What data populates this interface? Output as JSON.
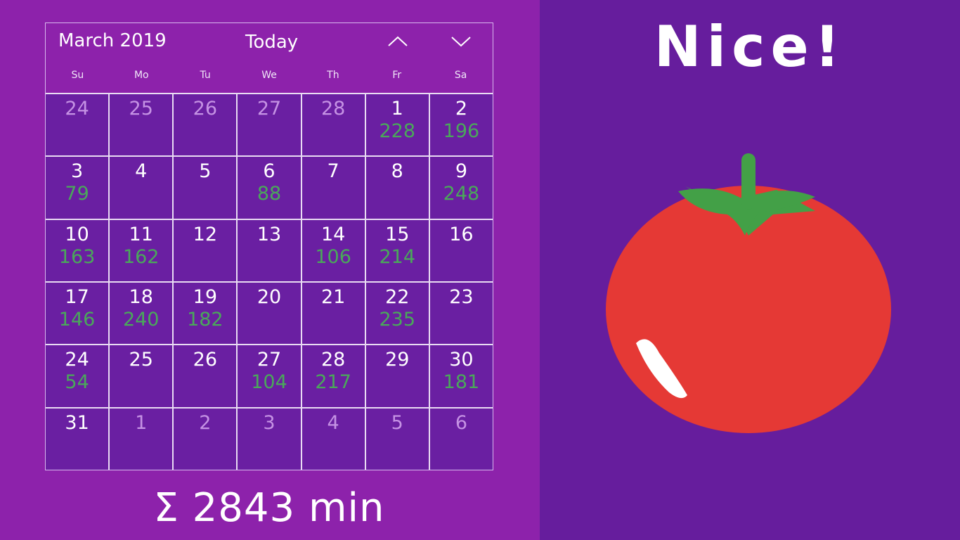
{
  "calendar": {
    "month_label": "March 2019",
    "today_label": "Today",
    "weekdays": [
      "Su",
      "Mo",
      "Tu",
      "We",
      "Th",
      "Fr",
      "Sa"
    ],
    "days": [
      {
        "n": "24",
        "m": "",
        "other": true
      },
      {
        "n": "25",
        "m": "",
        "other": true
      },
      {
        "n": "26",
        "m": "",
        "other": true
      },
      {
        "n": "27",
        "m": "",
        "other": true
      },
      {
        "n": "28",
        "m": "",
        "other": true
      },
      {
        "n": "1",
        "m": "228",
        "other": false
      },
      {
        "n": "2",
        "m": "196",
        "other": false
      },
      {
        "n": "3",
        "m": "79",
        "other": false
      },
      {
        "n": "4",
        "m": "",
        "other": false
      },
      {
        "n": "5",
        "m": "",
        "other": false
      },
      {
        "n": "6",
        "m": "88",
        "other": false
      },
      {
        "n": "7",
        "m": "",
        "other": false
      },
      {
        "n": "8",
        "m": "",
        "other": false
      },
      {
        "n": "9",
        "m": "248",
        "other": false
      },
      {
        "n": "10",
        "m": "163",
        "other": false
      },
      {
        "n": "11",
        "m": "162",
        "other": false
      },
      {
        "n": "12",
        "m": "",
        "other": false
      },
      {
        "n": "13",
        "m": "",
        "other": false
      },
      {
        "n": "14",
        "m": "106",
        "other": false
      },
      {
        "n": "15",
        "m": "214",
        "other": false
      },
      {
        "n": "16",
        "m": "",
        "other": false
      },
      {
        "n": "17",
        "m": "146",
        "other": false
      },
      {
        "n": "18",
        "m": "240",
        "other": false
      },
      {
        "n": "19",
        "m": "182",
        "other": false
      },
      {
        "n": "20",
        "m": "",
        "other": false
      },
      {
        "n": "21",
        "m": "",
        "other": false
      },
      {
        "n": "22",
        "m": "235",
        "other": false
      },
      {
        "n": "23",
        "m": "",
        "other": false
      },
      {
        "n": "24",
        "m": "54",
        "other": false
      },
      {
        "n": "25",
        "m": "",
        "other": false
      },
      {
        "n": "26",
        "m": "",
        "other": false
      },
      {
        "n": "27",
        "m": "104",
        "other": false
      },
      {
        "n": "28",
        "m": "217",
        "other": false
      },
      {
        "n": "29",
        "m": "",
        "other": false
      },
      {
        "n": "30",
        "m": "181",
        "other": false
      },
      {
        "n": "31",
        "m": "",
        "other": false
      },
      {
        "n": "1",
        "m": "",
        "other": true
      },
      {
        "n": "2",
        "m": "",
        "other": true
      },
      {
        "n": "3",
        "m": "",
        "other": true
      },
      {
        "n": "4",
        "m": "",
        "other": true
      },
      {
        "n": "5",
        "m": "",
        "other": true
      },
      {
        "n": "6",
        "m": "",
        "other": true
      }
    ]
  },
  "total_label": "Σ 2843 min",
  "message": "Nice!",
  "icons": {
    "prev": "chevron-up-icon",
    "next": "chevron-down-icon",
    "tomato": "tomato-icon"
  },
  "colors": {
    "left_bg": "#8d22ab",
    "right_bg": "#661d9d",
    "cell_bg": "#6a1fa2",
    "minutes": "#4aa85a",
    "tomato": "#e53935",
    "leaf": "#43a047"
  }
}
